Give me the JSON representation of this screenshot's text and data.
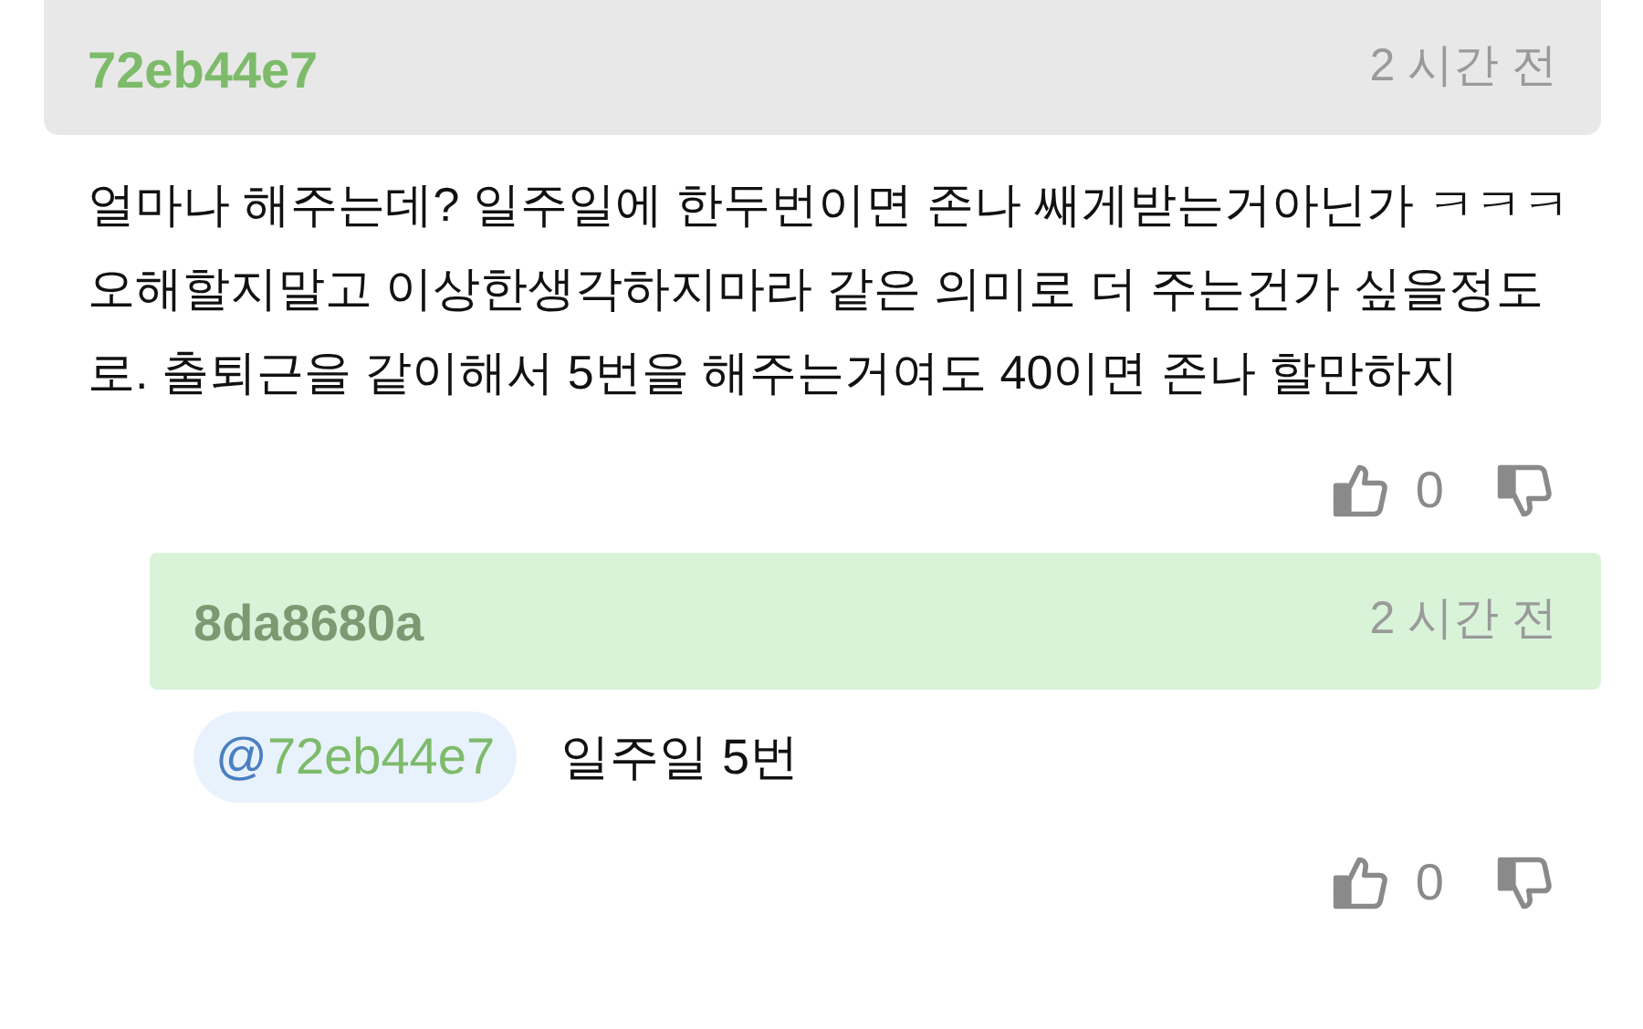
{
  "comments": [
    {
      "kind": "comment",
      "author": "72eb44e7",
      "time": "2 시간 전",
      "body": "얼마나 해주는데? 일주일에 한두번이면 존나 쌔게받는거아닌가 ㅋㅋㅋ 오해할지말고 이상한생각하지마라 같은 의미로 더 주는건가 싶을정도로. 출퇴근을 같이해서 5번을 해주는거여도 40이면 존나 할만하지",
      "likes": "0"
    },
    {
      "kind": "reply",
      "author": "8da8680a",
      "time": "2 시간 전",
      "mention": "@72eb44e7",
      "body": "일주일 5번",
      "likes": "0"
    }
  ]
}
